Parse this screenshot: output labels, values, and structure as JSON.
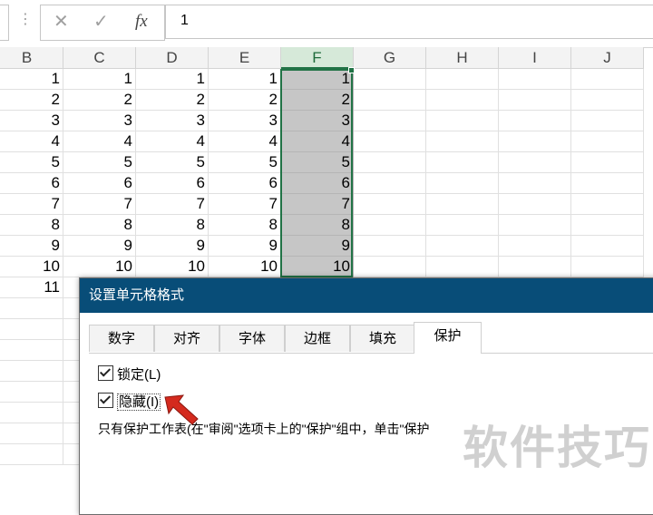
{
  "formula_bar": {
    "more_glyph": "⋮",
    "cancel_glyph": "✕",
    "enter_glyph": "✓",
    "fx_label": "fx",
    "content": "1"
  },
  "columns": [
    "B",
    "C",
    "D",
    "E",
    "F",
    "G",
    "H",
    "I",
    "J"
  ],
  "selected_column": "F",
  "rows": [
    [
      "1",
      "1",
      "1",
      "1",
      "1"
    ],
    [
      "2",
      "2",
      "2",
      "2",
      "2"
    ],
    [
      "3",
      "3",
      "3",
      "3",
      "3"
    ],
    [
      "4",
      "4",
      "4",
      "4",
      "4"
    ],
    [
      "5",
      "5",
      "5",
      "5",
      "5"
    ],
    [
      "6",
      "6",
      "6",
      "6",
      "6"
    ],
    [
      "7",
      "7",
      "7",
      "7",
      "7"
    ],
    [
      "8",
      "8",
      "8",
      "8",
      "8"
    ],
    [
      "9",
      "9",
      "9",
      "9",
      "9"
    ],
    [
      "10",
      "10",
      "10",
      "10",
      "10"
    ],
    [
      "11"
    ]
  ],
  "dialog": {
    "title": "设置单元格格式",
    "tabs": [
      "数字",
      "对齐",
      "字体",
      "边框",
      "填充",
      "保护"
    ],
    "active_tab": "保护",
    "locked_label": "锁定(L)",
    "locked_checked": true,
    "hidden_label": "隐藏(I)",
    "hidden_checked": true,
    "description": "只有保护工作表(在\"审阅\"选项卡上的\"保护\"组中，单击\"保护"
  },
  "watermark": "软件技巧",
  "colors": {
    "accent": "#217346",
    "dialog_title_bg": "#084d78",
    "selection_fill": "#c6c6c6",
    "arrow": "#d42a1e"
  }
}
